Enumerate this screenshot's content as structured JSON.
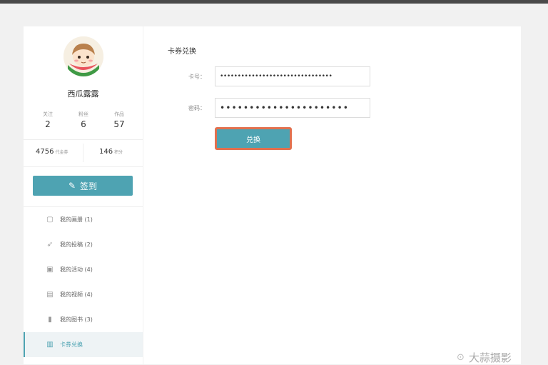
{
  "profile": {
    "username": "西瓜露露",
    "stats": [
      {
        "label": "关注",
        "value": "2"
      },
      {
        "label": "粉丝",
        "value": "6"
      },
      {
        "label": "作品",
        "value": "57"
      }
    ],
    "coins": {
      "value": "4756",
      "unit": "代金券"
    },
    "credits": {
      "value": "146",
      "unit": "积分"
    },
    "signin_label": "签到"
  },
  "menu": [
    {
      "label": "我的画册 (1)",
      "icon": "album-icon"
    },
    {
      "label": "我的投稿 (2)",
      "icon": "submit-icon"
    },
    {
      "label": "我的活动 (4)",
      "icon": "activity-icon"
    },
    {
      "label": "我的视频 (4)",
      "icon": "video-icon"
    },
    {
      "label": "我的图书 (3)",
      "icon": "book-icon"
    },
    {
      "label": "卡券兑换",
      "icon": "coupon-icon",
      "active": true
    }
  ],
  "redeem": {
    "title": "卡券兑换",
    "card_label": "卡号：",
    "card_value": "••••••••••••••••••••••••••••••••",
    "password_label": "密码：",
    "password_value": "••••••••••••••••••••••",
    "button_label": "兑换"
  },
  "watermark": {
    "text": "大蒜摄影"
  },
  "colors": {
    "accent": "#4ea3b2",
    "highlight_border": "#e2704e"
  }
}
